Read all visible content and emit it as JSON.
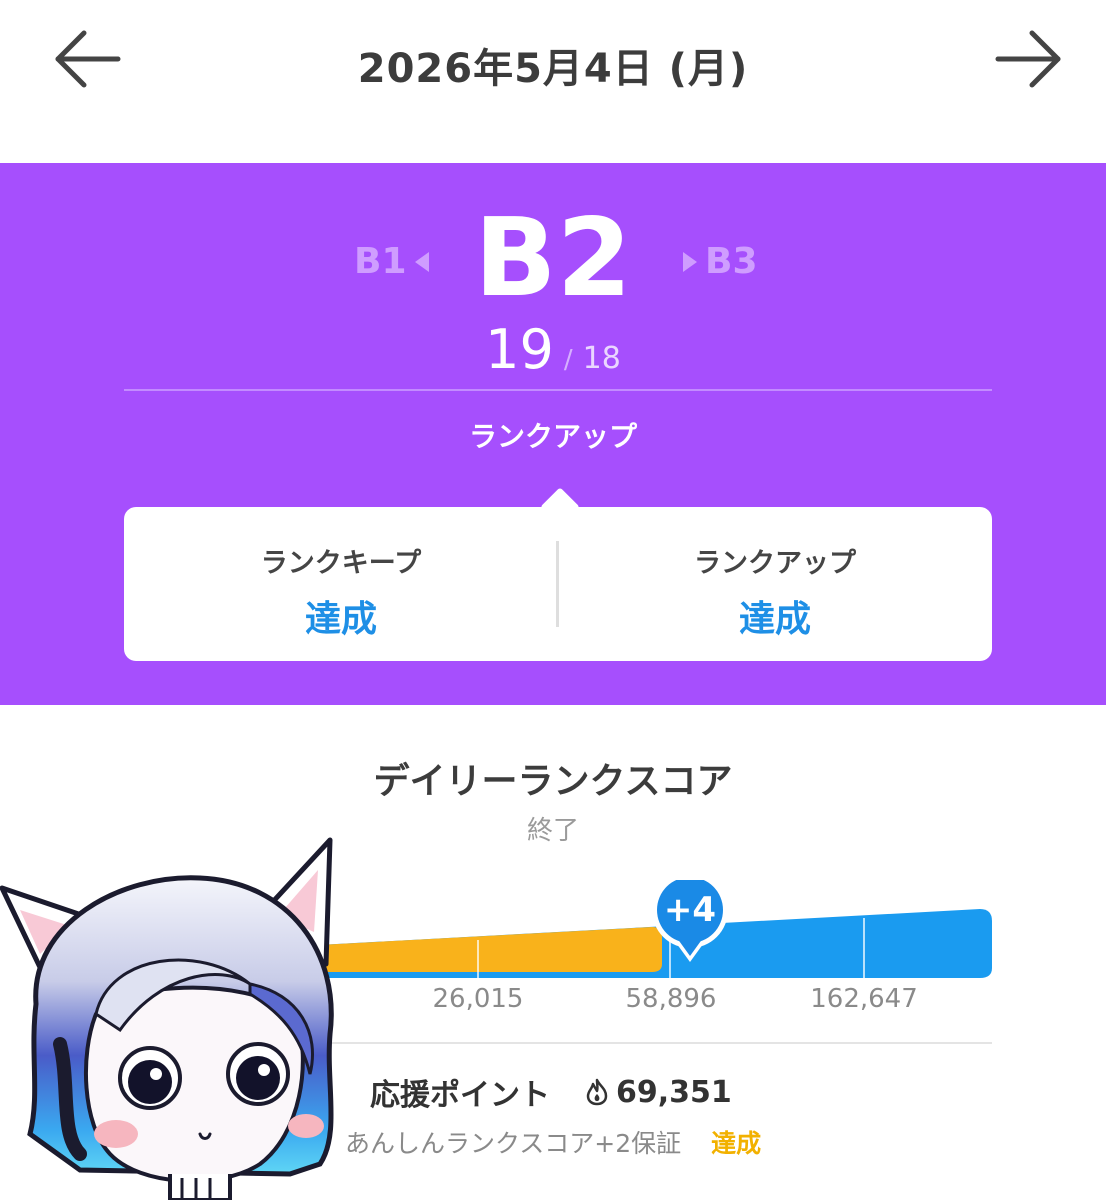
{
  "header": {
    "date_title": "2026年5月4日 (月)",
    "prev_icon": "arrow-left-icon",
    "next_icon": "arrow-right-icon"
  },
  "rank": {
    "prev": "B1",
    "current": "B2",
    "next": "B3",
    "count_current": "19",
    "count_separator": "/",
    "count_total": "18",
    "result": "ランクアップ",
    "panel_color": "#a64ffd"
  },
  "result_card": {
    "keep_label": "ランクキープ",
    "keep_status": "達成",
    "up_label": "ランクアップ",
    "up_status": "達成",
    "status_color": "#1e8fe6"
  },
  "daily_score": {
    "title": "デイリーランクスコア",
    "status": "終了",
    "badge": "+4",
    "ticks": [
      "26,015",
      "58,896",
      "162,647"
    ],
    "fill_color": "#f9b21b",
    "bar_color": "#1a9bf0"
  },
  "support": {
    "label": "応援ポイント",
    "icon": "flame-icon",
    "value": "69,351",
    "guarantee_text": "あんしんランクスコア+2保証",
    "guarantee_status": "達成",
    "guarantee_color": "#f2b100"
  }
}
